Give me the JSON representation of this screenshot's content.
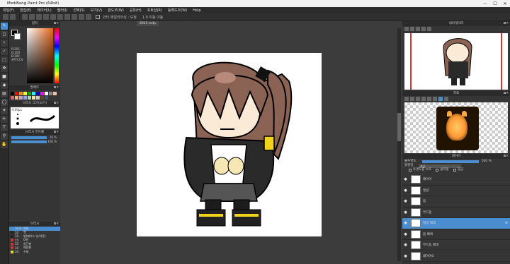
{
  "app": {
    "title": "MediBang Paint Pro (64bit)"
  },
  "window_controls": {
    "minimize": "—",
    "maximize": "☐",
    "close": "✕"
  },
  "menu": [
    "파일(F)",
    "편집(E)",
    "레이어(L)",
    "필터(I)",
    "선택(S)",
    "보기(V)",
    "윈도우(W)",
    "공유(H)",
    "포토샵(R)",
    "등록도우(W)",
    "Help"
  ],
  "toolbar": {
    "snap_label": "안티 에일리어싱 : 보정",
    "zoom_label": "1.0 이동 이동"
  },
  "left": {
    "color_panel_title": "컬러",
    "rgb_text": [
      "R:255",
      "G:204",
      "B:100",
      "#FFCC4"
    ],
    "palette_title": "팔레트",
    "palette_colors": [
      "#000000",
      "#ff0000",
      "#ff8800",
      "#ffff00",
      "#00aa00",
      "#00ffff",
      "#0000ff",
      "#ff00ff",
      "#ffffff",
      "#888888",
      "#f4c2a0",
      "#d46a6a",
      "#e9b57a",
      "#c4a3d4",
      "#8fa8d8",
      "#aad4b8",
      "#f7e1a0",
      "#cccccc",
      "#654321",
      "#335577"
    ],
    "brush_title": "브러시 크기(보기)",
    "brush_size_label": "9.00px",
    "brush_ctrl_title": "브러시 컨트롤",
    "size_value": "16 %",
    "opacity_value": "100 %",
    "nav_title": "브러시",
    "nav_items": [
      {
        "num": "16.0",
        "name": "연필",
        "color": "#4a8ed0",
        "selected": true
      },
      {
        "num": "10",
        "name": "펜",
        "color": "#222222",
        "selected": false
      },
      {
        "num": "10",
        "name": "펜(페이드 인/아웃)",
        "color": "#222222",
        "selected": false
      },
      {
        "num": "15",
        "name": "G펜",
        "color": "#cc3333",
        "selected": false
      },
      {
        "num": "15",
        "name": "둥근펜",
        "color": "#cc3333",
        "selected": false
      },
      {
        "num": "10",
        "name": "매핑펜",
        "color": "#cc3333",
        "selected": false
      },
      {
        "num": "10",
        "name": "수채",
        "color": "#dddd33",
        "selected": false
      }
    ]
  },
  "canvas": {
    "doc_tab": "8945.mdp"
  },
  "right": {
    "navigator_title": "네비게이터",
    "reference_title": "자료",
    "layer_title": "레이어",
    "opacity_label": "불투명도",
    "opacity_value": "100 %",
    "blend_label": "블렌딩",
    "blend_value": "표준",
    "protect_label": "투명도를 보호",
    "clip_label": "클리핑",
    "lock_label": "잠금",
    "layers": [
      {
        "name": "레이어",
        "selected": false
      },
      {
        "name": "얼굴",
        "selected": false
      },
      {
        "name": "몸",
        "selected": false
      },
      {
        "name": "무드등",
        "selected": false
      },
      {
        "name": "얼굴 배색",
        "selected": true
      },
      {
        "name": "몸 배색",
        "selected": false
      },
      {
        "name": "무드등 배색",
        "selected": false
      },
      {
        "name": "레이어0",
        "selected": false
      }
    ]
  }
}
